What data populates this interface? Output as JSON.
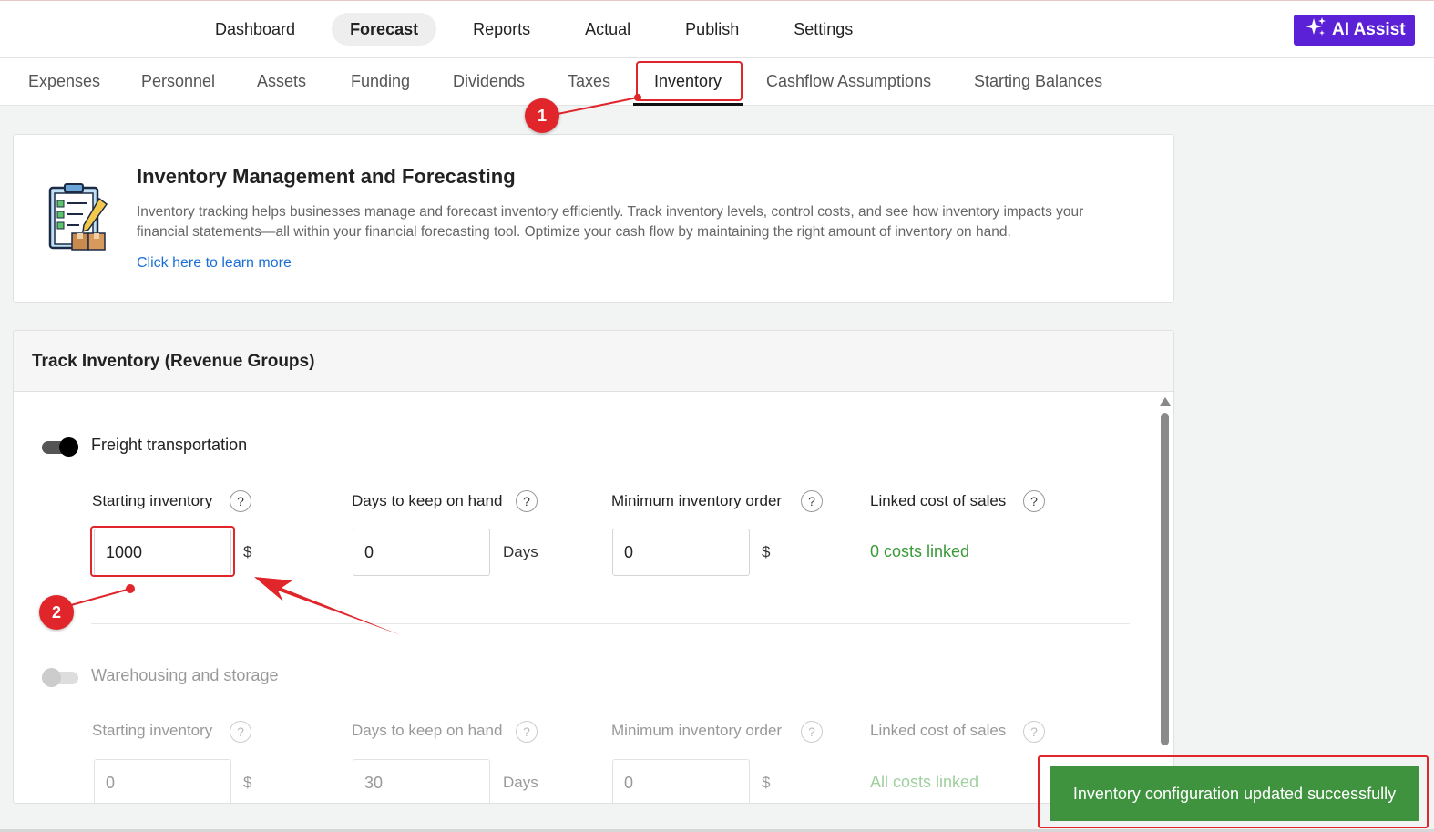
{
  "topnav": {
    "items": [
      "Dashboard",
      "Forecast",
      "Reports",
      "Actual",
      "Publish",
      "Settings"
    ],
    "active": "Forecast",
    "ai_assist_label": "AI Assist"
  },
  "subnav": {
    "items": [
      "Expenses",
      "Personnel",
      "Assets",
      "Funding",
      "Dividends",
      "Taxes",
      "Inventory",
      "Cashflow Assumptions",
      "Starting Balances"
    ],
    "active": "Inventory"
  },
  "info": {
    "title": "Inventory Management and Forecasting",
    "description": "Inventory tracking helps businesses manage and forecast inventory efficiently. Track inventory levels, control costs, and see how inventory impacts your financial statements—all within your financial forecasting tool. Optimize your cash flow by maintaining the right amount of inventory on hand.",
    "link": "Click here to learn more"
  },
  "track": {
    "title": "Track Inventory (Revenue Groups)",
    "labels": {
      "starting_inventory": "Starting inventory",
      "days_on_hand": "Days to keep on hand",
      "min_order": "Minimum inventory order",
      "linked_cost": "Linked cost of sales",
      "help": "?",
      "currency": "$",
      "days": "Days"
    },
    "groups": [
      {
        "name": "Freight transportation",
        "enabled": true,
        "starting_inventory": "1000",
        "days_on_hand": "0",
        "min_order": "0",
        "linked_cost": "0 costs linked"
      },
      {
        "name": "Warehousing and storage",
        "enabled": false,
        "starting_inventory": "0",
        "days_on_hand": "30",
        "min_order": "0",
        "linked_cost": "All costs linked"
      }
    ]
  },
  "annotations": {
    "step1": "1",
    "step2": "2"
  },
  "toast": {
    "message": "Inventory configuration updated successfully"
  },
  "colors": {
    "accent_purple": "#5b21d6",
    "annotation_red": "#e0252b",
    "success_green": "#3f933f",
    "link_blue": "#1a6fd6"
  }
}
